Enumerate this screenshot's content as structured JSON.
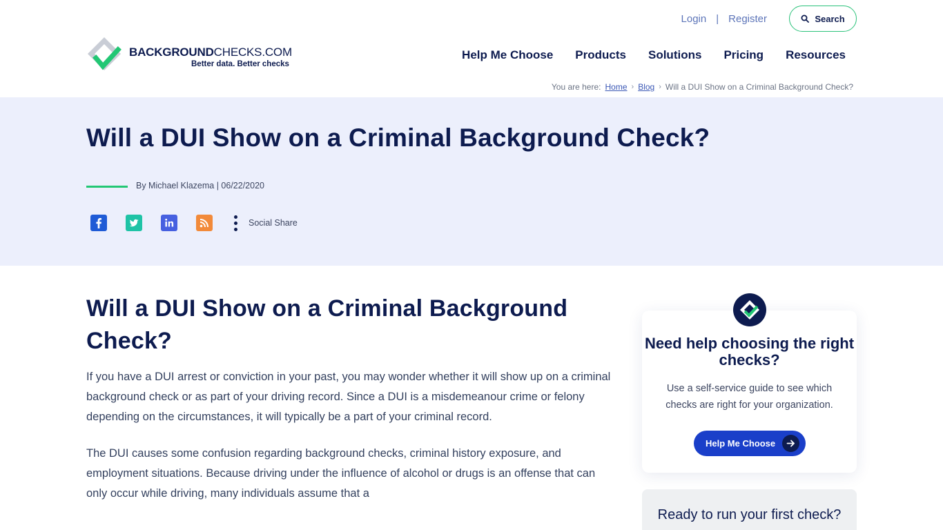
{
  "header": {
    "logo": {
      "word_bold": "BACKGROUND",
      "word_light": "CHECKS.COM",
      "tag_part1": "Better data.",
      "tag_part2": "Better checks"
    },
    "util": {
      "login": "Login",
      "separator": "|",
      "register": "Register",
      "search": "Search"
    },
    "nav": [
      "Help Me Choose",
      "Products",
      "Solutions",
      "Pricing",
      "Resources"
    ],
    "breadcrumb": {
      "prefix": "You are here:",
      "home": "Home",
      "blog": "Blog",
      "current": "Will a DUI Show on a Criminal Background Check?",
      "separator": "›"
    }
  },
  "hero": {
    "title": "Will a DUI Show on a Criminal Background Check?",
    "byline": "By Michael Klazema | 06/22/2020",
    "social_label": "Social Share"
  },
  "article": {
    "heading": "Will a DUI Show on a Criminal Background Check?",
    "paragraphs": [
      "If you have a DUI arrest or conviction in your past, you may wonder whether it will show up on a criminal background check or as part of your driving record. Since a DUI is a misdemeanour crime or felony depending on the circumstances, it will typically be a part of your criminal record.",
      "The DUI causes some confusion regarding background checks, criminal history exposure, and employment situations. Because driving under the influence of alcohol or drugs is an offense that can only occur while driving, many individuals assume that a"
    ]
  },
  "sidebar": {
    "help_card": {
      "title": "Need help choosing the right checks?",
      "description": "Use a self-service guide to see which checks are right for your organization.",
      "button": "Help Me Choose"
    },
    "ready_card": {
      "title": "Ready to run your first check?"
    }
  },
  "colors": {
    "navy": "#0d1b4f",
    "green": "#22c774",
    "hero_bg": "#eceffc",
    "cta_blue": "#1a3fc9"
  }
}
